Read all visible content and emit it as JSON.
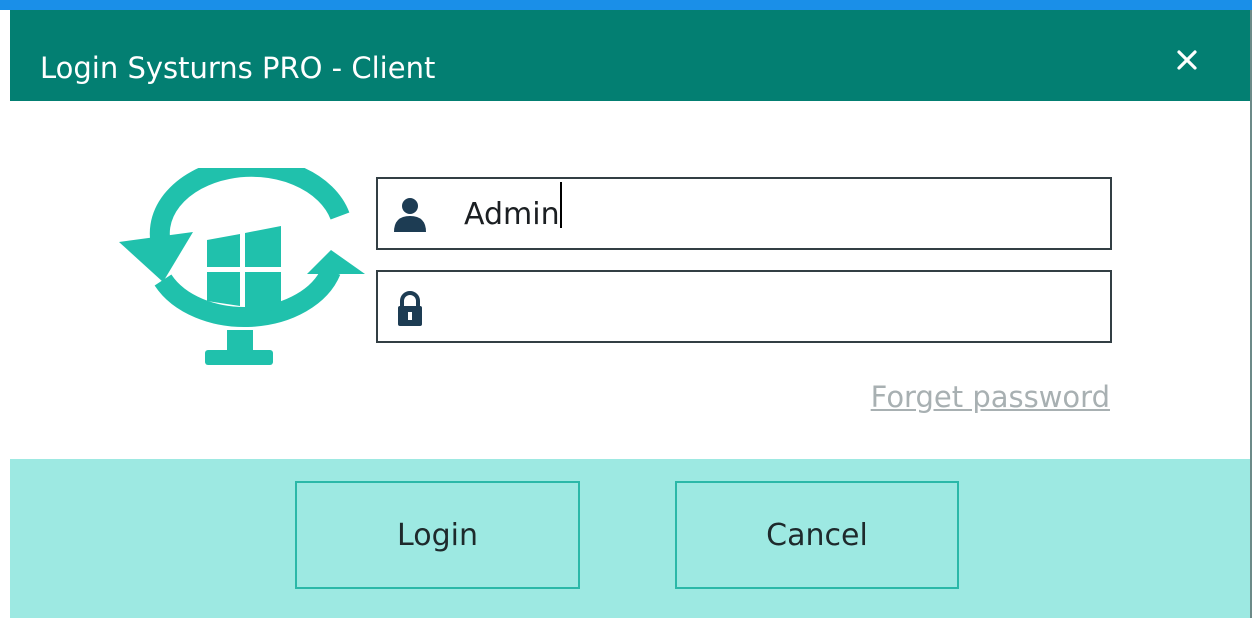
{
  "window": {
    "title": "Login Systurns PRO - Client"
  },
  "icons": {
    "close": "close-icon",
    "logo": "windows-sync-monitor-logo",
    "user": "user-icon",
    "lock": "lock-icon"
  },
  "form": {
    "username_value": "Admin",
    "password_value": "",
    "forget_label": "Forget password"
  },
  "buttons": {
    "login_label": "Login",
    "cancel_label": "Cancel"
  },
  "colors": {
    "titlebar": "#037f72",
    "accent": "#20c1ac",
    "footer": "#9de9e2",
    "field_icon": "#1d3c53"
  }
}
